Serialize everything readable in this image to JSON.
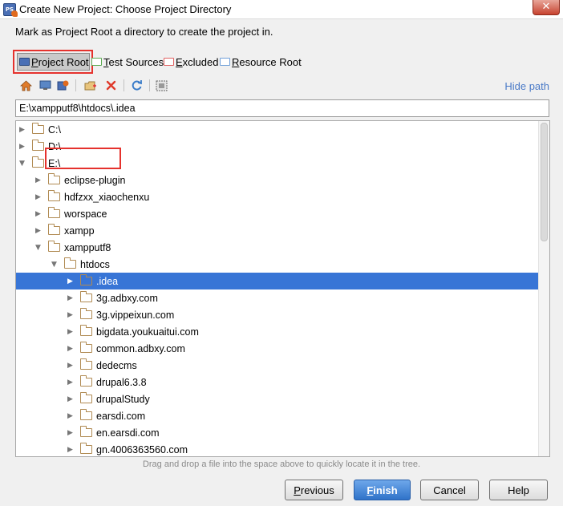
{
  "window": {
    "title": "Create New Project: Choose Project Directory",
    "close_glyph": "✕"
  },
  "description": "Mark as Project Root a directory to create the project in.",
  "mark_as": [
    {
      "label": "Project Root",
      "mnemonic": "P",
      "rest": "roject Root",
      "color": "#e06a1e"
    },
    {
      "label": "Test Sources",
      "mnemonic": "T",
      "rest": "est Sources",
      "color": "#5aa84f"
    },
    {
      "label": "Excluded",
      "mnemonic": "E",
      "rest": "xcluded",
      "color": "#e06060"
    },
    {
      "label": "Resource Root",
      "mnemonic": "R",
      "rest": "esource Root",
      "color": "#6f9fd8"
    }
  ],
  "toolbar": {
    "icons": [
      "home-icon",
      "desktop-icon",
      "project-icon",
      "new-folder-icon",
      "delete-icon",
      "refresh-icon",
      "show-hidden-icon"
    ],
    "hide_path": "Hide path"
  },
  "path": {
    "value": "E:\\xampputf8\\htdocs\\.idea"
  },
  "tree": [
    {
      "name": "C:\\",
      "depth": 0,
      "state": "collapsed",
      "selected": false
    },
    {
      "name": "D:\\",
      "depth": 0,
      "state": "collapsed",
      "selected": false
    },
    {
      "name": "E:\\",
      "depth": 0,
      "state": "expanded",
      "selected": false
    },
    {
      "name": "eclipse-plugin",
      "depth": 1,
      "state": "collapsed",
      "selected": false
    },
    {
      "name": "hdfzxx_xiaochenxu",
      "depth": 1,
      "state": "collapsed",
      "selected": false
    },
    {
      "name": "worspace",
      "depth": 1,
      "state": "collapsed",
      "selected": false
    },
    {
      "name": "xampp",
      "depth": 1,
      "state": "collapsed",
      "selected": false
    },
    {
      "name": "xampputf8",
      "depth": 1,
      "state": "expanded",
      "selected": false
    },
    {
      "name": "htdocs",
      "depth": 2,
      "state": "expanded",
      "selected": false
    },
    {
      "name": ".idea",
      "depth": 3,
      "state": "collapsed",
      "selected": true
    },
    {
      "name": "3g.adbxy.com",
      "depth": 3,
      "state": "collapsed",
      "selected": false
    },
    {
      "name": "3g.vippeixun.com",
      "depth": 3,
      "state": "collapsed",
      "selected": false
    },
    {
      "name": "bigdata.youkuaitui.com",
      "depth": 3,
      "state": "collapsed",
      "selected": false
    },
    {
      "name": "common.adbxy.com",
      "depth": 3,
      "state": "collapsed",
      "selected": false
    },
    {
      "name": "dedecms",
      "depth": 3,
      "state": "collapsed",
      "selected": false
    },
    {
      "name": "drupal6.3.8",
      "depth": 3,
      "state": "collapsed",
      "selected": false
    },
    {
      "name": "drupalStudy",
      "depth": 3,
      "state": "collapsed",
      "selected": false
    },
    {
      "name": "earsdi.com",
      "depth": 3,
      "state": "collapsed",
      "selected": false
    },
    {
      "name": "en.earsdi.com",
      "depth": 3,
      "state": "collapsed",
      "selected": false
    },
    {
      "name": "gn.4006363560.com",
      "depth": 3,
      "state": "collapsed",
      "selected": false
    }
  ],
  "hint": "Drag and drop a file into the space above to quickly locate it in the tree.",
  "buttons": {
    "previous": {
      "mnemonic": "P",
      "rest": "revious"
    },
    "finish": {
      "mnemonic": "F",
      "rest": "inish"
    },
    "cancel": {
      "label": "Cancel"
    },
    "help": {
      "label": "Help"
    }
  }
}
